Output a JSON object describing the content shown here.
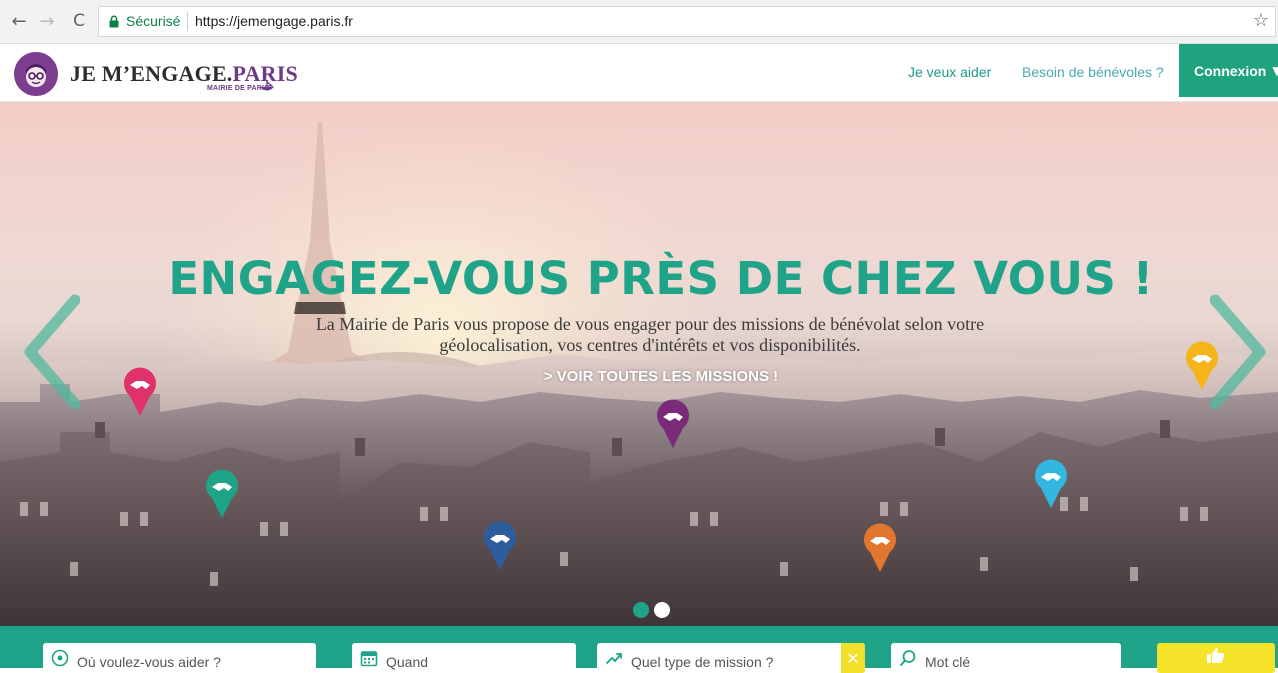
{
  "browser": {
    "secure_label": "Sécurisé",
    "url": "https://jemengage.paris.fr",
    "bookmark_icon": "star-icon"
  },
  "header": {
    "logo": {
      "name_main": "JE M’ENGAGE.",
      "name_paris": "PARIS",
      "subtitle": "MAIRIE DE PARIS"
    },
    "nav": {
      "help_label": "Je veux aider",
      "volunteers_label": "Besoin de bénévoles ?",
      "login_label": "Connexion"
    }
  },
  "hero": {
    "headline": "ENGAGEZ-VOUS PRÈS DE CHEZ VOUS !",
    "subline_1": "La Mairie de Paris vous propose de vous engager pour des missions de bénévolat selon votre",
    "subline_2": "géolocalisation, vos centres d'intérêts et vos disponibilités.",
    "cta_label": "> VOIR TOUTES LES MISSIONS !",
    "slides_total": 2,
    "slide_active": 1
  },
  "search": {
    "where_placeholder": "Où voulez-vous aider ?",
    "when_placeholder": "Quand",
    "type_placeholder": "Quel type de mission ?",
    "keyword_placeholder": "Mot clé"
  },
  "colors": {
    "brand_green": "#1fa48a",
    "brand_purple": "#6d3a86",
    "accent_yellow": "#f5e32a",
    "pin_pink": "#e0326a",
    "pin_green": "#1fa48a",
    "pin_purple": "#7a2a78",
    "pin_blue": "#2d5d9c",
    "pin_orange": "#e2762f",
    "pin_cyan": "#33b6e0",
    "pin_yellow": "#f4b41a"
  }
}
